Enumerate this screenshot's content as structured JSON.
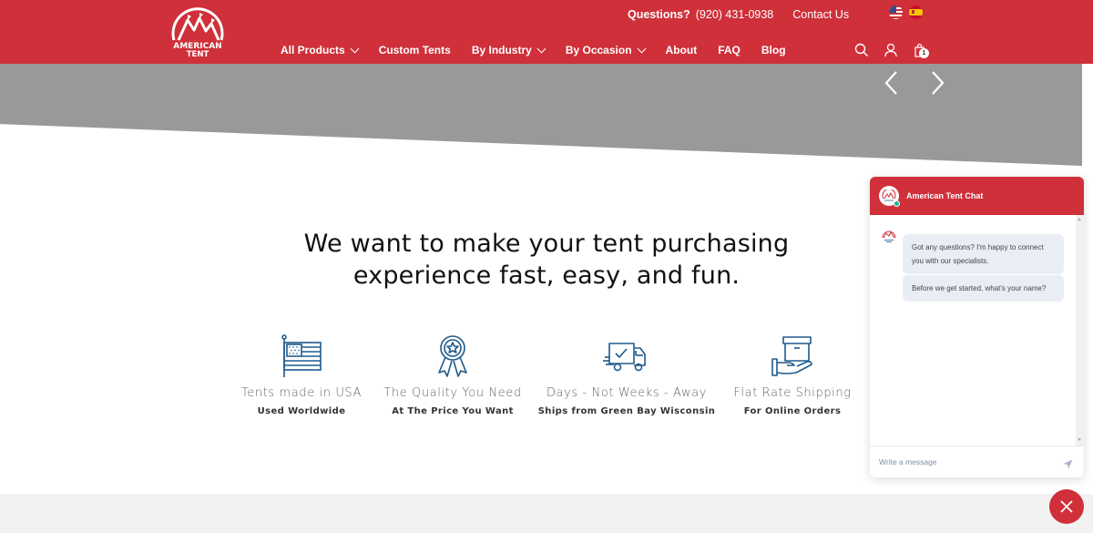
{
  "header": {
    "logo_text_line1": "AMERICAN",
    "logo_text_line2": "TENT",
    "questions_label": "Questions?",
    "phone": "(920) 431-0938",
    "contact_label": "Contact Us",
    "languages": [
      "English (US flag)",
      "Spanish (Spain flag)"
    ],
    "nav": [
      {
        "label": "All Products",
        "dropdown": true
      },
      {
        "label": "Custom Tents",
        "dropdown": false
      },
      {
        "label": "By Industry",
        "dropdown": true
      },
      {
        "label": "By Occasion",
        "dropdown": true
      },
      {
        "label": "About",
        "dropdown": false
      },
      {
        "label": "FAQ",
        "dropdown": false
      },
      {
        "label": "Blog",
        "dropdown": false
      }
    ],
    "icons": [
      "search-icon",
      "user-icon",
      "cart-icon"
    ],
    "cart_count": "1",
    "brand_color": "#cf303a"
  },
  "hero": {
    "background_color": "#999999",
    "prev_icon": "chevron-left-icon",
    "next_icon": "chevron-right-icon"
  },
  "main": {
    "headline_line1": "We want to make your tent purchasing",
    "headline_line2": "experience fast, easy, and fun.",
    "features": [
      {
        "icon": "us-flag-icon",
        "title": "Tents made in USA",
        "subtitle": "Used Worldwide"
      },
      {
        "icon": "award-ribbon-icon",
        "title": "The Quality You Need",
        "subtitle": "At The Price You Want"
      },
      {
        "icon": "delivery-truck-icon",
        "title": "Days - Not Weeks - Away",
        "subtitle": "Ships from Green Bay Wisconsin"
      },
      {
        "icon": "box-in-hand-icon",
        "title": "Flat Rate Shipping",
        "subtitle": "For Online Orders"
      }
    ],
    "icon_color": "#1e5a8c"
  },
  "chat": {
    "title": "American Tent Chat",
    "status": "online",
    "messages": [
      {
        "from": "bot",
        "text": "Got any questions? I'm happy to connect you with our specialists."
      },
      {
        "from": "bot",
        "text": "Before we get started, what's your name?"
      }
    ],
    "input_placeholder": "Write a message",
    "input_value": ""
  }
}
